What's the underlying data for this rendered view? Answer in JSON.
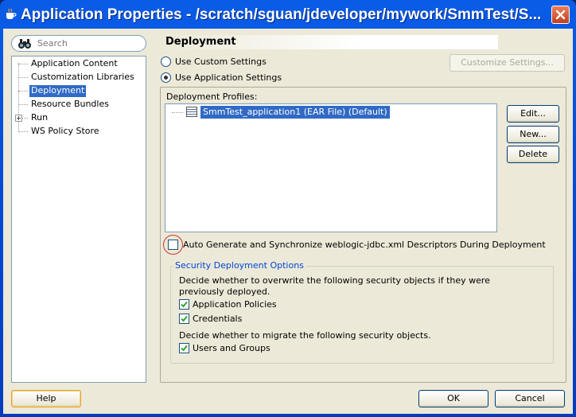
{
  "window": {
    "title": "Application Properties - /scratch/sguan/jdeveloper/mywork/SmmTest/S..."
  },
  "search": {
    "placeholder": "Search"
  },
  "nav": {
    "items": [
      {
        "label": "Application Content"
      },
      {
        "label": "Customization Libraries"
      },
      {
        "label": "Deployment"
      },
      {
        "label": "Resource Bundles"
      },
      {
        "label": "Run"
      },
      {
        "label": "WS Policy Store"
      }
    ],
    "selected": "Deployment"
  },
  "main": {
    "heading": "Deployment",
    "radio_custom": "Use Custom Settings",
    "radio_app": "Use Application Settings",
    "customize_button": "Customize Settings...",
    "profiles_label": "Deployment Profiles:",
    "profile_item": "SmmTest_application1 (EAR File) (Default)",
    "edit_button": "Edit...",
    "new_button": "New...",
    "delete_button": "Delete",
    "auto_generate_label": "Auto Generate and Synchronize weblogic-jdbc.xml Descriptors During Deployment"
  },
  "security": {
    "legend": "Security Deployment Options",
    "overwrite_text": "Decide whether to overwrite the following security objects if they were previously deployed.",
    "app_policies": "Application Policies",
    "credentials": "Credentials",
    "migrate_text": "Decide whether to migrate the following security objects.",
    "users_groups": "Users and Groups"
  },
  "footer": {
    "help": "Help",
    "ok": "OK",
    "cancel": "Cancel"
  },
  "colors": {
    "title_bar": "#0046d5",
    "selection": "#316ac5",
    "legend_text": "#0046d5",
    "highlight_ring": "#d43030"
  }
}
